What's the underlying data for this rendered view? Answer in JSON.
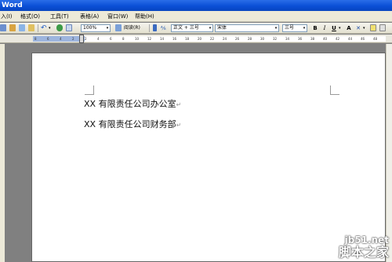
{
  "window": {
    "title": "Word"
  },
  "menu": {
    "items": [
      "入(I)",
      "格式(O)",
      "工具(T)",
      "表格(A)",
      "窗口(W)",
      "帮助(H)"
    ]
  },
  "toolbar": {
    "zoom": "100%",
    "read_label": "阅读(R)",
    "style": "正文 + 三号",
    "font": "宋体",
    "size": "三号",
    "bold": "B",
    "italic": "I",
    "underline": "U",
    "char_scale": "A"
  },
  "ruler": {
    "ticks": [
      "8",
      "6",
      "4",
      "2",
      "2",
      "4",
      "6",
      "8",
      "10",
      "12",
      "14",
      "16",
      "18",
      "20",
      "22",
      "24",
      "26",
      "28",
      "30",
      "32",
      "34",
      "36",
      "38",
      "40",
      "42",
      "44",
      "46",
      "48"
    ]
  },
  "document": {
    "lines": [
      "XX 有限责任公司办公室",
      "XX 有限责任公司财务部"
    ],
    "paragraph_mark": "↵"
  },
  "watermark": {
    "line1": "jb51.net",
    "line2": "脚本之家"
  }
}
